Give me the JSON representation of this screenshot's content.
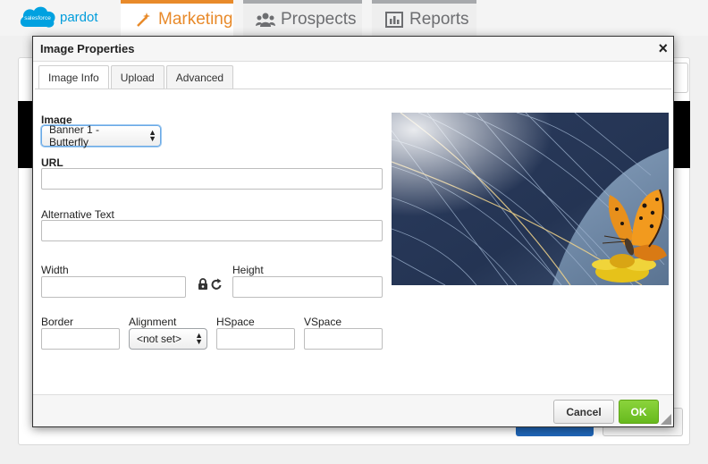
{
  "brand": {
    "logo_text": "salesforce",
    "product": "pardot"
  },
  "nav": {
    "tabs": [
      {
        "label": "Marketing",
        "icon": "wand-icon",
        "active": true
      },
      {
        "label": "Prospects",
        "icon": "users-icon",
        "active": false
      },
      {
        "label": "Reports",
        "icon": "bar-chart-icon",
        "active": false
      }
    ]
  },
  "dialog": {
    "title": "Image Properties",
    "close_icon": "×",
    "tabs": [
      {
        "label": "Image Info",
        "active": true
      },
      {
        "label": "Upload",
        "active": false
      },
      {
        "label": "Advanced",
        "active": false
      }
    ],
    "image": {
      "label": "Image",
      "selected": "Banner 1 - Butterfly"
    },
    "url": {
      "label": "URL",
      "value": ""
    },
    "alt": {
      "label": "Alternative Text",
      "value": ""
    },
    "width": {
      "label": "Width",
      "value": ""
    },
    "height": {
      "label": "Height",
      "value": ""
    },
    "border": {
      "label": "Border",
      "value": ""
    },
    "alignment": {
      "label": "Alignment",
      "selected": "<not set>"
    },
    "hspace": {
      "label": "HSpace",
      "value": ""
    },
    "vspace": {
      "label": "VSpace",
      "value": ""
    },
    "preview": {
      "subject": "butterfly on flower in front of solar panels"
    },
    "buttons": {
      "cancel": "Cancel",
      "ok": "OK"
    }
  },
  "colors": {
    "accent_orange": "#e88a2a",
    "ok_green": "#67b91e",
    "salesforce_blue": "#009ddc"
  }
}
